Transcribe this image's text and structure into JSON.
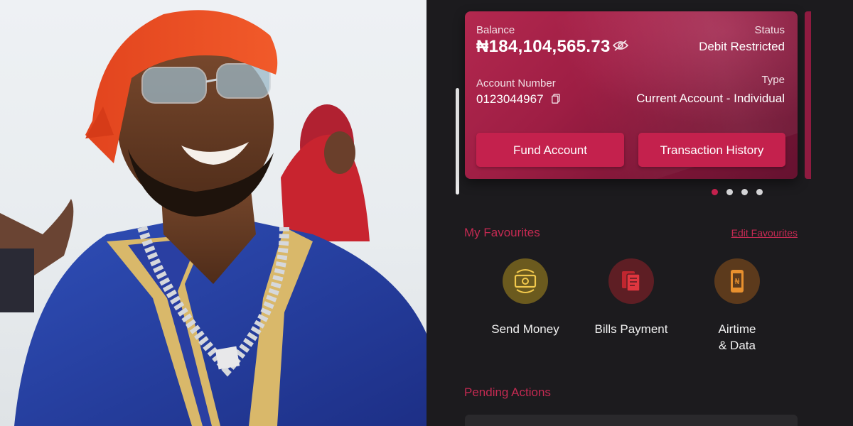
{
  "card": {
    "balance_label": "Balance",
    "balance_value": "₦184,104,565.73",
    "status_label": "Status",
    "status_value": "Debit Restricted",
    "account_number_label": "Account Number",
    "account_number_value": "0123044967",
    "type_label": "Type",
    "type_value": "Current Account - Individual",
    "fund_button": "Fund Account",
    "history_button": "Transaction History"
  },
  "pager": {
    "count": 4,
    "active_index": 0
  },
  "favourites": {
    "title": "My Favourites",
    "edit_link": "Edit Favourites",
    "items": [
      {
        "label": "Send Money",
        "icon": "cash-transfer-icon",
        "color": "#6b5a1e"
      },
      {
        "label": "Bills Payment",
        "icon": "bills-icon",
        "color": "#5e1e24"
      },
      {
        "label": "Airtime\n& Data",
        "icon": "phone-naira-icon",
        "color": "#5c3a1c"
      }
    ]
  },
  "pending": {
    "title": "Pending Actions"
  },
  "colors": {
    "accent": "#c4214d",
    "card_gradient_start": "#b3284f",
    "card_gradient_end": "#651230",
    "background": "#1c1b1e"
  }
}
